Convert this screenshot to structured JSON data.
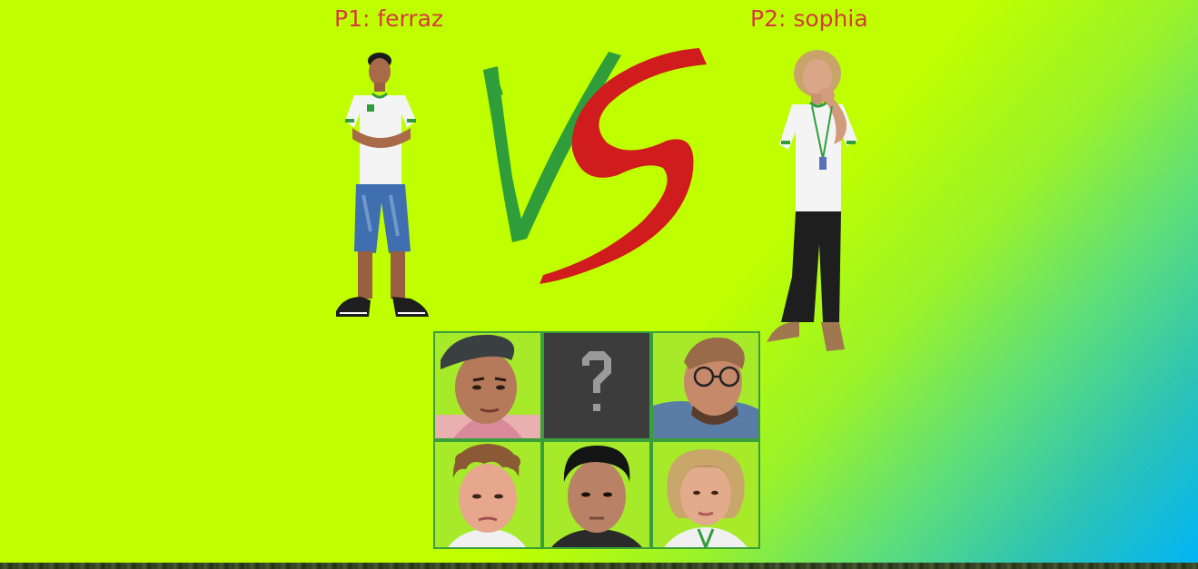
{
  "players": {
    "p1": {
      "label": "P1: ferraz"
    },
    "p2": {
      "label": "P2: sophia"
    }
  },
  "vs": {
    "text": "VS",
    "colors": {
      "v": "#2f9e3a",
      "s": "#d01c1c"
    }
  },
  "roster": [
    {
      "slot": "fighter-cap",
      "icon": "person-cap-portrait"
    },
    {
      "slot": "random",
      "icon": "question-mark-icon"
    },
    {
      "slot": "fighter-glasses",
      "icon": "person-glasses-portrait"
    },
    {
      "slot": "fighter-curly",
      "icon": "person-curly-hair-portrait"
    },
    {
      "slot": "fighter-darkhair",
      "icon": "person-dark-hair-portrait"
    },
    {
      "slot": "fighter-blonde",
      "icon": "person-blonde-portrait"
    }
  ],
  "colors": {
    "background": "#bfff00",
    "gradient_end": "#00b4f7",
    "label": "#d43c3c",
    "grid_border": "#3a9f3a"
  }
}
